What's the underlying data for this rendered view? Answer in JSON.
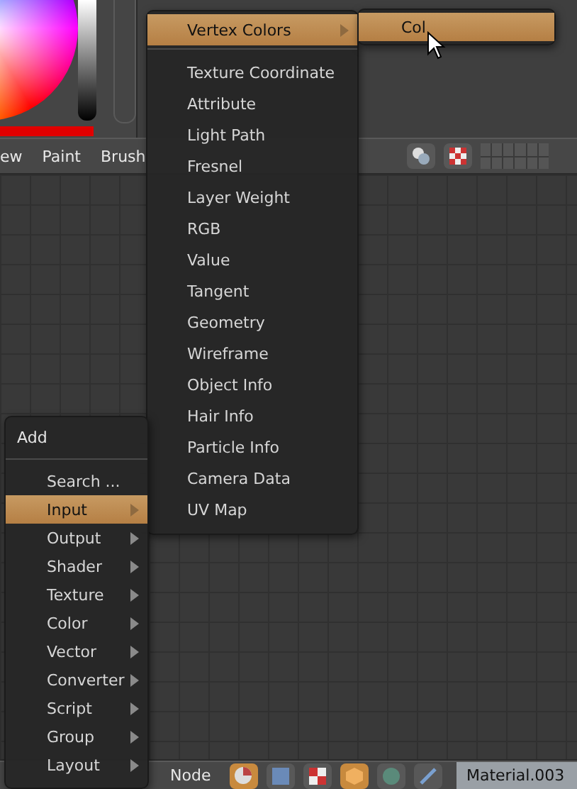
{
  "top_header": {
    "menus": [
      "ew",
      "Paint",
      "Brush"
    ]
  },
  "input_menu": {
    "items": [
      {
        "label": "Vertex Colors",
        "has_submenu": true,
        "selected": true
      },
      {
        "label": "Texture Coordinate",
        "has_submenu": false,
        "selected": false
      },
      {
        "label": "Attribute",
        "has_submenu": false,
        "selected": false
      },
      {
        "label": "Light Path",
        "has_submenu": false,
        "selected": false
      },
      {
        "label": "Fresnel",
        "has_submenu": false,
        "selected": false
      },
      {
        "label": "Layer Weight",
        "has_submenu": false,
        "selected": false
      },
      {
        "label": "RGB",
        "has_submenu": false,
        "selected": false
      },
      {
        "label": "Value",
        "has_submenu": false,
        "selected": false
      },
      {
        "label": "Tangent",
        "has_submenu": false,
        "selected": false
      },
      {
        "label": "Geometry",
        "has_submenu": false,
        "selected": false
      },
      {
        "label": "Wireframe",
        "has_submenu": false,
        "selected": false
      },
      {
        "label": "Object Info",
        "has_submenu": false,
        "selected": false
      },
      {
        "label": "Hair Info",
        "has_submenu": false,
        "selected": false
      },
      {
        "label": "Particle Info",
        "has_submenu": false,
        "selected": false
      },
      {
        "label": "Camera Data",
        "has_submenu": false,
        "selected": false
      },
      {
        "label": "UV Map",
        "has_submenu": false,
        "selected": false
      }
    ]
  },
  "vertex_colors_menu": {
    "items": [
      {
        "label": "Col",
        "selected": true
      }
    ]
  },
  "add_menu": {
    "title": "Add",
    "items": [
      {
        "label": "Search ...",
        "has_submenu": false,
        "selected": false
      },
      {
        "label": "Input",
        "has_submenu": true,
        "selected": true
      },
      {
        "label": "Output",
        "has_submenu": true,
        "selected": false
      },
      {
        "label": "Shader",
        "has_submenu": true,
        "selected": false
      },
      {
        "label": "Texture",
        "has_submenu": true,
        "selected": false
      },
      {
        "label": "Color",
        "has_submenu": true,
        "selected": false
      },
      {
        "label": "Vector",
        "has_submenu": true,
        "selected": false
      },
      {
        "label": "Converter",
        "has_submenu": true,
        "selected": false
      },
      {
        "label": "Script",
        "has_submenu": true,
        "selected": false
      },
      {
        "label": "Group",
        "has_submenu": true,
        "selected": false
      },
      {
        "label": "Layout",
        "has_submenu": true,
        "selected": false
      }
    ]
  },
  "bottom_header": {
    "menus": [
      "Node"
    ],
    "material": "Material.003"
  }
}
